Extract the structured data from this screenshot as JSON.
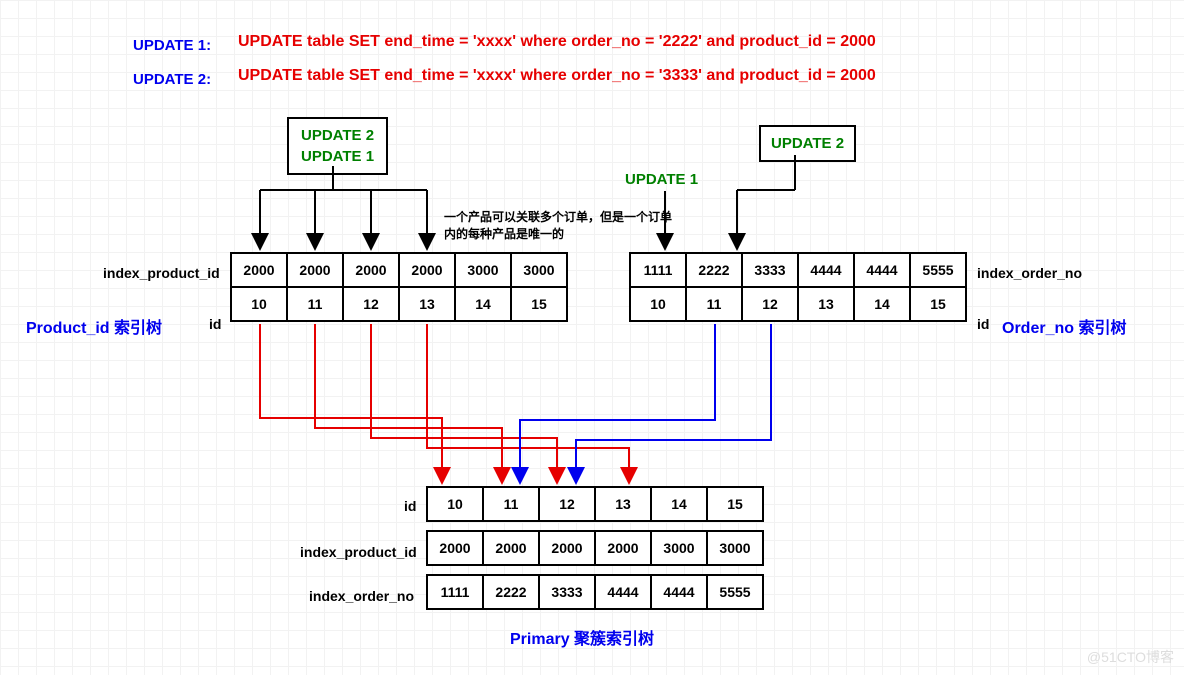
{
  "updates": {
    "u1_label": "UPDATE 1:",
    "u1_sql": "UPDATE table SET end_time = 'xxxx' where order_no = '2222' and product_id = 2000",
    "u2_label": "UPDATE 2:",
    "u2_sql": "UPDATE table SET end_time = 'xxxx' where order_no = '3333' and product_id = 2000"
  },
  "boxes": {
    "left_box_line1": "UPDATE 2",
    "left_box_line2": "UPDATE 1",
    "right_box": "UPDATE 2",
    "mid_label": "UPDATE 1"
  },
  "note": "一个产品可以关联多个订单，但是一个订单内的每种产品是唯一的",
  "left_tree": {
    "title": "Product_id 索引树",
    "row1_label": "index_product_id",
    "row1": [
      "2000",
      "2000",
      "2000",
      "2000",
      "3000",
      "3000"
    ],
    "row2_label": "id",
    "row2": [
      "10",
      "11",
      "12",
      "13",
      "14",
      "15"
    ]
  },
  "right_tree": {
    "title": "Order_no 索引树",
    "row1_label": "index_order_no",
    "row1": [
      "1111",
      "2222",
      "3333",
      "4444",
      "4444",
      "5555"
    ],
    "row2_label": "id",
    "row2": [
      "10",
      "11",
      "12",
      "13",
      "14",
      "15"
    ]
  },
  "primary": {
    "title": "Primary 聚簇索引树",
    "row1_label": "id",
    "row1": [
      "10",
      "11",
      "12",
      "13",
      "14",
      "15"
    ],
    "row2_label": "index_product_id",
    "row2": [
      "2000",
      "2000",
      "2000",
      "2000",
      "3000",
      "3000"
    ],
    "row3_label": "index_order_no",
    "row3": [
      "1111",
      "2222",
      "3333",
      "4444",
      "4444",
      "5555"
    ]
  },
  "watermark": "@51CTO博客"
}
